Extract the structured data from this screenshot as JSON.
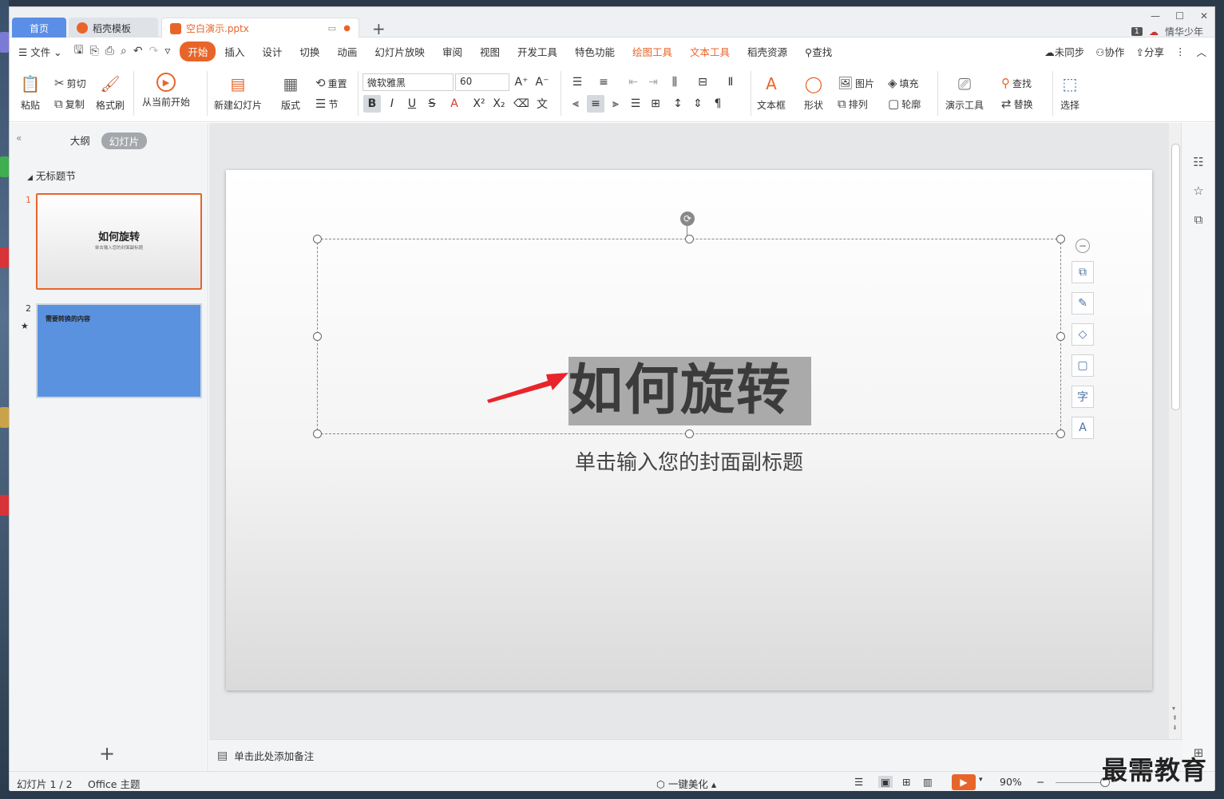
{
  "tabs": {
    "home": "首页",
    "docer": "稻壳模板",
    "doc": "空白演示.pptx"
  },
  "title_right": {
    "badge": "1",
    "user": "情华少年"
  },
  "menu": {
    "file": "文件",
    "items": [
      "开始",
      "插入",
      "设计",
      "切换",
      "动画",
      "幻灯片放映",
      "审阅",
      "视图",
      "开发工具",
      "特色功能",
      "绘图工具",
      "文本工具",
      "稻壳资源"
    ],
    "search": "查找",
    "right": [
      "未同步",
      "协作",
      "分享"
    ]
  },
  "ribbon": {
    "paste": "粘贴",
    "cut": "剪切",
    "copy": "复制",
    "format_painter": "格式刷",
    "from_current": "从当前开始",
    "new_slide": "新建幻灯片",
    "layout": "版式",
    "reset": "重置",
    "section": "节",
    "font_name": "微软雅黑",
    "font_size": "60",
    "text_box": "文本框",
    "shape": "形状",
    "picture": "图片",
    "arrange": "排列",
    "fill": "填充",
    "outline": "轮廓",
    "present_tools": "演示工具",
    "find": "查找",
    "replace": "替换",
    "select": "选择"
  },
  "left_panel": {
    "tab_outline": "大纲",
    "tab_slides": "幻灯片",
    "section": "无标题节",
    "slides": [
      {
        "num": "1",
        "title": "如何旋转",
        "subtitle": "单击输入您的封面副标题"
      },
      {
        "num": "2",
        "title": "需要转换的内容"
      }
    ]
  },
  "slide": {
    "title": "如何旋转",
    "subtitle": "单击输入您的封面副标题"
  },
  "notes": {
    "placeholder": "单击此处添加备注"
  },
  "status": {
    "slide_pos": "幻灯片 1 / 2",
    "theme": "Office 主题",
    "beautify": "一键美化",
    "zoom": "90%"
  },
  "watermark": "最需教育",
  "colors": {
    "accent": "#e8652a",
    "tab_blue": "#5b8ee6",
    "slide2_bg": "#5b92e0"
  }
}
